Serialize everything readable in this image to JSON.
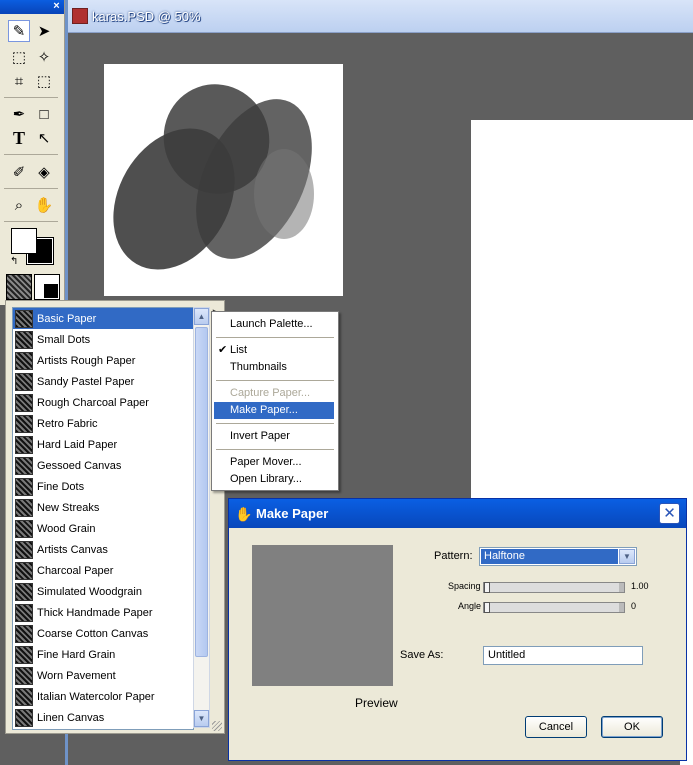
{
  "document": {
    "title": "karas.PSD @ 50%"
  },
  "toolbox": {
    "close_glyph": "×",
    "tools": [
      {
        "name": "brush-tool",
        "glyph": "✎"
      },
      {
        "name": "layer-adjuster-tool",
        "glyph": "➤"
      },
      {
        "name": "rect-selection-tool",
        "glyph": "⬚"
      },
      {
        "name": "magic-wand-tool",
        "glyph": "✧"
      },
      {
        "name": "crop-tool",
        "glyph": "⌗"
      },
      {
        "name": "transform-tool",
        "glyph": "⬚"
      },
      {
        "name": "pen-tool",
        "glyph": "✒"
      },
      {
        "name": "shape-tool",
        "glyph": "□"
      },
      {
        "name": "text-tool",
        "glyph": "T"
      },
      {
        "name": "selection-adjuster-tool",
        "glyph": "↖"
      },
      {
        "name": "dropper-tool",
        "glyph": "✐"
      },
      {
        "name": "paint-bucket-tool",
        "glyph": "◈"
      },
      {
        "name": "magnifier-tool",
        "glyph": "⌕"
      },
      {
        "name": "grabber-tool",
        "glyph": "✋"
      }
    ],
    "swap_glyph": "↰"
  },
  "paper_list": {
    "items": [
      "Basic Paper",
      "Small Dots",
      "Artists Rough Paper",
      "Sandy Pastel Paper",
      "Rough Charcoal Paper",
      "Retro Fabric",
      "Hard Laid Paper",
      "Gessoed Canvas",
      "Fine Dots",
      "New Streaks",
      "Wood Grain",
      "Artists Canvas",
      "Charcoal Paper",
      "Simulated Woodgrain",
      "Thick Handmade Paper",
      "Coarse Cotton Canvas",
      "Fine Hard Grain",
      "Worn Pavement",
      "Italian Watercolor Paper",
      "Linen Canvas"
    ],
    "selected": "Basic Paper",
    "menu_glyph": "▸",
    "scroll_up": "▲",
    "scroll_down": "▼"
  },
  "context_menu": {
    "items": {
      "launch_palette": "Launch Palette...",
      "list": "List",
      "thumbnails": "Thumbnails",
      "capture_paper": "Capture Paper...",
      "make_paper": "Make Paper...",
      "invert_paper": "Invert Paper",
      "paper_mover": "Paper Mover...",
      "open_library": "Open Library..."
    },
    "check_glyph": "✔"
  },
  "dialog": {
    "title": "Make Paper",
    "close_glyph": "✕",
    "hand_glyph": "✋",
    "pattern_label": "Pattern:",
    "pattern_value": "Halftone",
    "spacing_label": "Spacing",
    "spacing_value": "1.00",
    "spacing_level": 0,
    "angle_label": "Angle",
    "angle_value": "0",
    "angle_level": 0,
    "save_as_label": "Save As:",
    "save_as_value": "Untitled",
    "preview_label": "Preview",
    "cancel": "Cancel",
    "ok": "OK",
    "dropdown_glyph": "▼"
  }
}
